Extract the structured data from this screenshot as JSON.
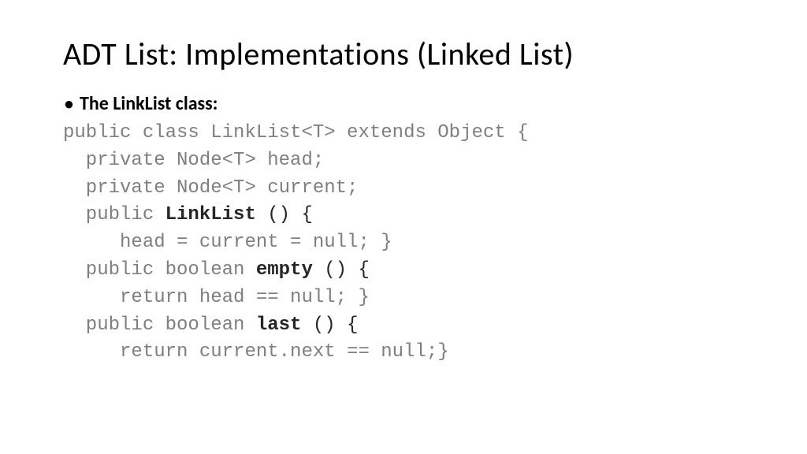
{
  "title": "ADT List: Implementations (Linked List)",
  "bullet": {
    "dot": "•",
    "text": "The LinkList class:"
  },
  "code": {
    "l1a": "public class LinkList<T> extends Object {",
    "l2a": "  private Node<T> head;",
    "l3a": "  private Node<T> current;",
    "l4a": "  public ",
    "l4b": "LinkList",
    "l4c": " () {",
    "l5a": "     head = current = null; }",
    "l6a": "  public boolean ",
    "l6b": "empty",
    "l6c": " () {",
    "l7a": "     return head == null; }",
    "l8a": "  public boolean ",
    "l8b": "last",
    "l8c": " () {",
    "l9a": "     return current.next == null;}"
  }
}
